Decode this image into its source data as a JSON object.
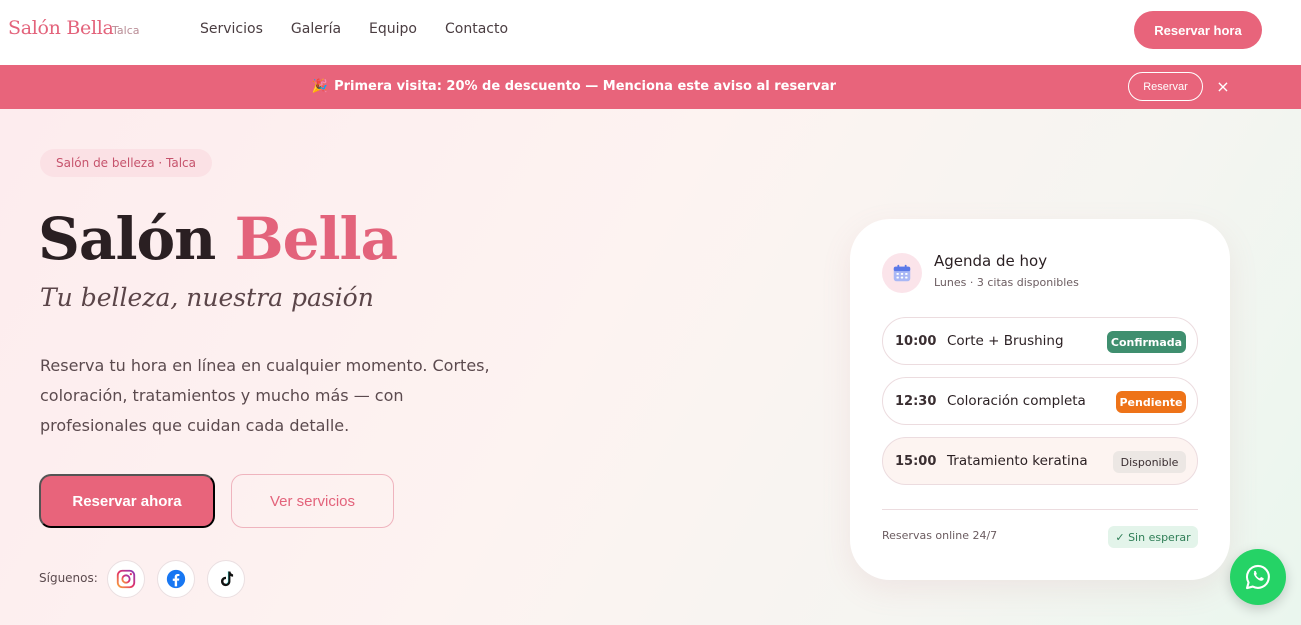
{
  "nav": {
    "brand": "Salón Bella",
    "city": "Talca",
    "links": [
      "Servicios",
      "Galería",
      "Equipo",
      "Contacto"
    ],
    "cta": "Reservar hora"
  },
  "promo": {
    "icon": "party-icon",
    "text": "Primera visita: 20% de descuento — Menciona este aviso al reservar",
    "button": "Reservar",
    "close": "×"
  },
  "hero": {
    "tag": "Salón de belleza · Talca",
    "title_main": "Salón",
    "title_accent": "Bella",
    "subtitle": "Tu belleza, nuestra pasión",
    "description": "Reserva tu hora en línea en cualquier momento. Cortes, coloración, tratamientos y mucho más — con profesionales que cuidan cada detalle.",
    "primary_button": "Reservar ahora",
    "secondary_button": "Ver servicios",
    "follow_label": "Síguenos:",
    "social": [
      "instagram-icon",
      "facebook-icon",
      "tiktok-icon"
    ]
  },
  "agenda": {
    "title": "Agenda de hoy",
    "subtitle": "Lunes · 3 citas disponibles",
    "slots": [
      {
        "time": "10:00",
        "service": "Corte + Brushing",
        "status": "Confirmada"
      },
      {
        "time": "12:30",
        "service": "Coloración completa",
        "status": "Pendiente"
      },
      {
        "time": "15:00",
        "service": "Tratamiento keratina",
        "status": "Disponible"
      }
    ],
    "footer_text": "Reservas online 24/7",
    "footer_badge": "✓ Sin esperar"
  },
  "colors": {
    "brand": "#e8647b",
    "confirmed": "#3f8f6f",
    "pending": "#ee7318",
    "whatsapp": "#25d366"
  }
}
